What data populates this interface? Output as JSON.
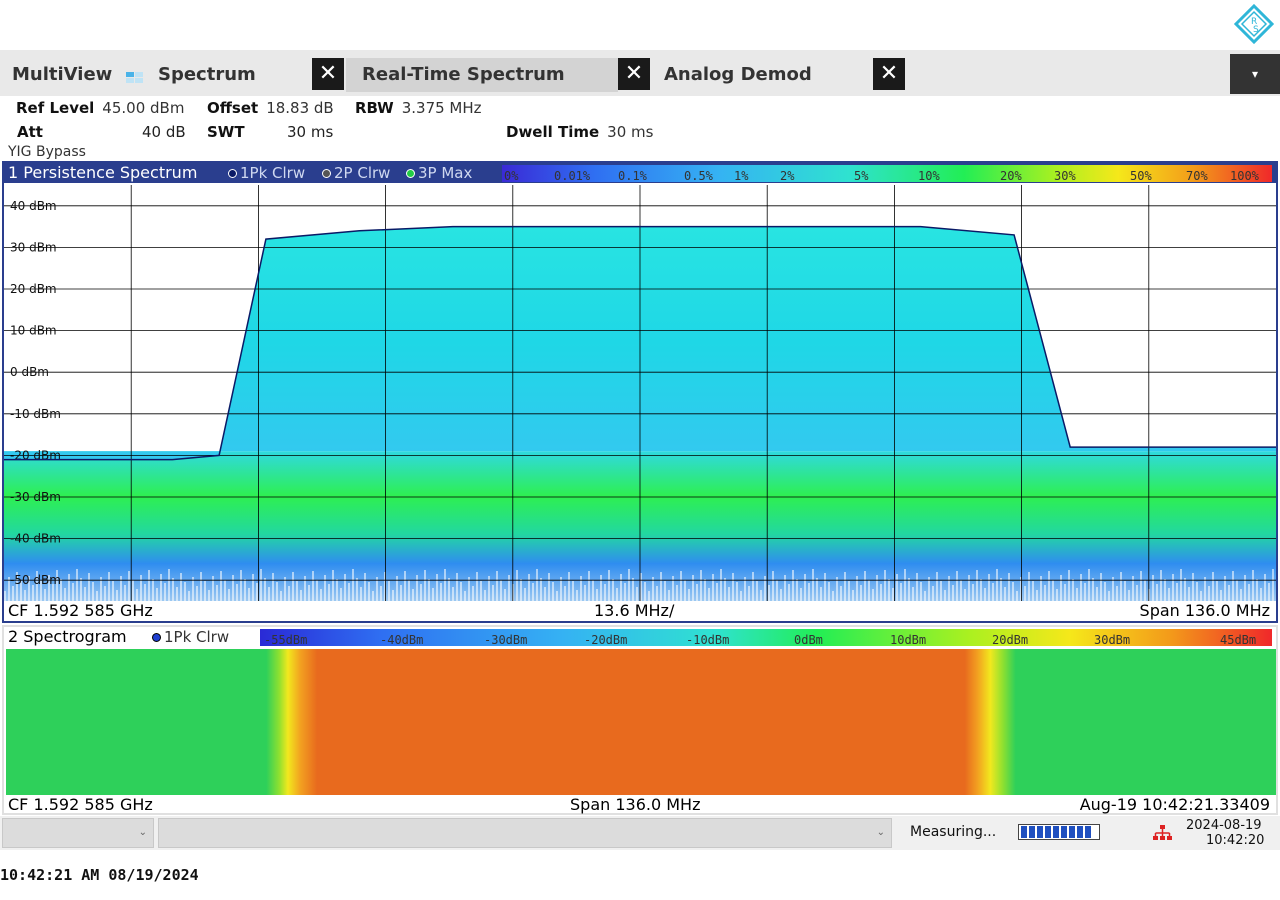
{
  "tabs": {
    "multiview": "MultiView",
    "spectrum": "Spectrum",
    "realtime": "Real-Time Spectrum",
    "analog": "Analog Demod",
    "close_glyph": "✕",
    "dropdown_glyph": "▾"
  },
  "settings": {
    "ref_level_label": "Ref Level",
    "ref_level_value": "45.00 dBm",
    "offset_label": "Offset",
    "offset_value": "18.83 dB",
    "rbw_label": "RBW",
    "rbw_value": "3.375 MHz",
    "att_label": "Att",
    "att_value": "40 dB",
    "swt_label": "SWT",
    "swt_value": "30 ms",
    "dwell_label": "Dwell Time",
    "dwell_value": "30 ms",
    "yig": "YIG Bypass"
  },
  "window1": {
    "title": "1 Persistence Spectrum",
    "traces": [
      {
        "label": "1Pk Clrw",
        "color": "#0a1a66"
      },
      {
        "label": "2P Clrw",
        "color": "#555555"
      },
      {
        "label": "3P Max",
        "color": "#22cc44"
      }
    ],
    "persistence_scale": [
      "0%",
      "0.01%",
      "0.1%",
      "0.5%",
      "1%",
      "2%",
      "5%",
      "10%",
      "20%",
      "30%",
      "50%",
      "70%",
      "100%"
    ],
    "footer_cf": "CF 1.592 585 GHz",
    "footer_div": "13.6 MHz/",
    "footer_span": "Span 136.0 MHz"
  },
  "window2": {
    "title": "2 Spectrogram",
    "trace": "1Pk Clrw",
    "level_scale": [
      "-55dBm",
      "-40dBm",
      "-30dBm",
      "-20dBm",
      "-10dBm",
      "0dBm",
      "10dBm",
      "20dBm",
      "30dBm",
      "45dBm"
    ],
    "footer_cf": "CF 1.592 585 GHz",
    "footer_span": "Span 136.0 MHz",
    "footer_time": "Aug-19 10:42:21.33409"
  },
  "statusbar": {
    "measuring": "Measuring...",
    "progress_fraction": 0.85,
    "date": "2024-08-19",
    "time": "10:42:20"
  },
  "bottom_stamp": "10:42:21 AM  08/19/2024",
  "chart_data": {
    "type": "line",
    "title": "1 Persistence Spectrum",
    "xlabel": "",
    "ylabel": "",
    "ylim": [
      -55,
      45
    ],
    "y_ticks": [
      "40 dBm",
      "30 dBm",
      "20 dBm",
      "10 dBm",
      "0 dBm",
      "-10 dBm",
      "-20 dBm",
      "-30 dBm",
      "-40 dBm",
      "-50 dBm"
    ],
    "x_center_ghz": 1.592585,
    "x_span_mhz": 136.0,
    "x": [
      -68,
      -60,
      -50,
      -45,
      -40,
      -30,
      -20,
      0,
      20,
      30,
      40,
      46,
      50,
      60,
      68
    ],
    "series": [
      {
        "name": "1Pk Clrw",
        "values": [
          -21,
          -21,
          -21,
          -20,
          32,
          34,
          35,
          35,
          35,
          35,
          33,
          -18,
          -18,
          -18,
          -18
        ]
      }
    ],
    "grid": true
  }
}
